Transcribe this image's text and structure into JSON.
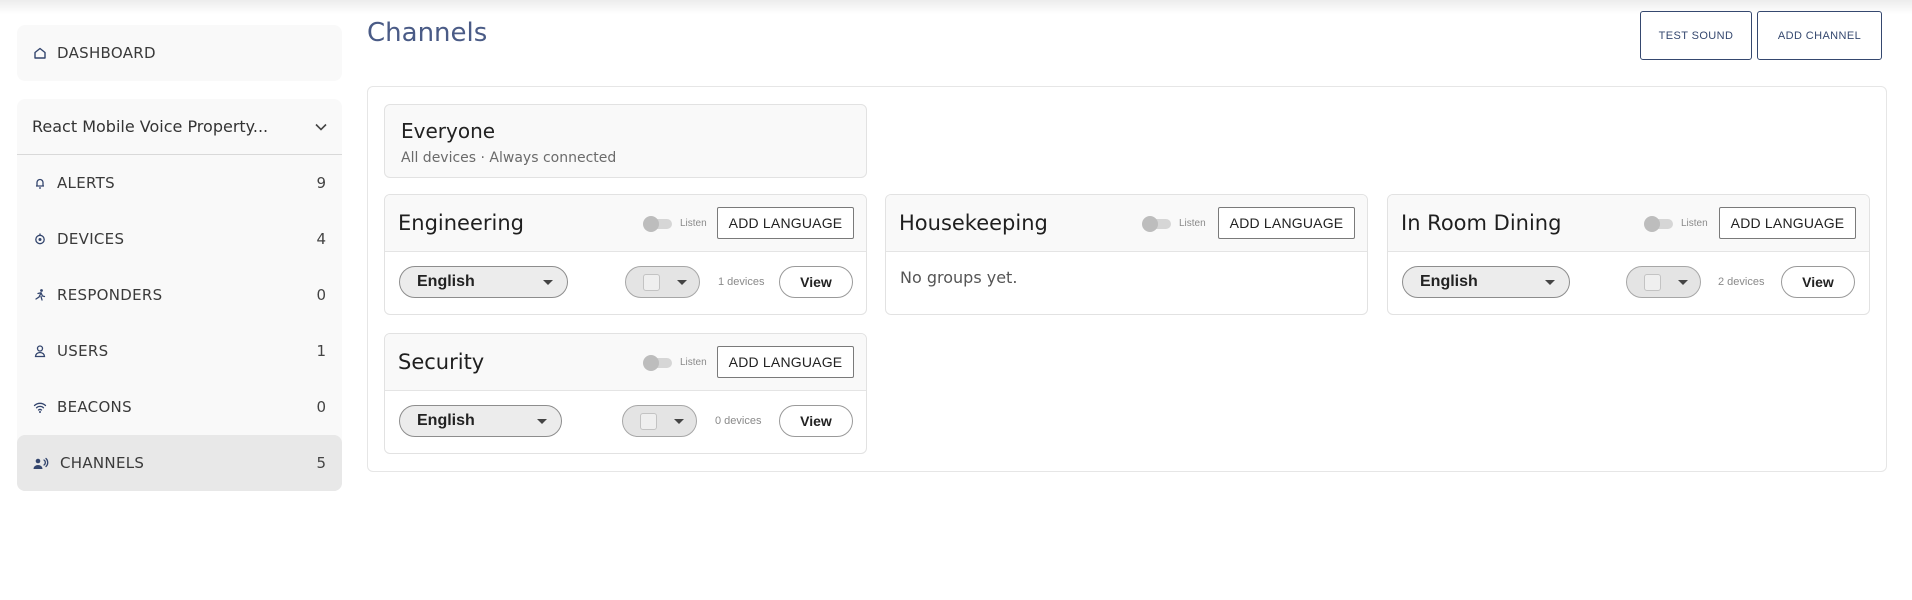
{
  "sidebar": {
    "dashboard": {
      "label": "DASHBOARD",
      "icon": "home-icon"
    },
    "property": {
      "label": "React Mobile Voice Property...",
      "icon": "chevron-down-icon"
    },
    "items": [
      {
        "label": "ALERTS",
        "count": "9",
        "icon": "bell-icon"
      },
      {
        "label": "DEVICES",
        "count": "4",
        "icon": "device-icon"
      },
      {
        "label": "RESPONDERS",
        "count": "0",
        "icon": "runner-icon"
      },
      {
        "label": "USERS",
        "count": "1",
        "icon": "user-icon"
      },
      {
        "label": "BEACONS",
        "count": "0",
        "icon": "wifi-icon"
      },
      {
        "label": "CHANNELS",
        "count": "5",
        "icon": "speaker-person-icon",
        "active": true
      }
    ]
  },
  "header": {
    "title": "Channels",
    "test_sound": "TEST SOUND",
    "add_channel": "ADD CHANNEL"
  },
  "everyone": {
    "title": "Everyone",
    "subtitle": "All devices · Always connected"
  },
  "channels": [
    {
      "name": "Engineering",
      "listen": "Listen",
      "add_language": "ADD LANGUAGE",
      "language": "English",
      "devices": "1 devices",
      "view": "View"
    },
    {
      "name": "Housekeeping",
      "listen": "Listen",
      "add_language": "ADD LANGUAGE",
      "empty": "No groups yet."
    },
    {
      "name": "In Room Dining",
      "listen": "Listen",
      "add_language": "ADD LANGUAGE",
      "language": "English",
      "devices": "2 devices",
      "view": "View"
    },
    {
      "name": "Security",
      "listen": "Listen",
      "add_language": "ADD LANGUAGE",
      "language": "English",
      "devices": "0 devices",
      "view": "View"
    }
  ],
  "colors": {
    "accent": "#35486f",
    "title": "#4a5b86",
    "active_bg": "#e8e8e8"
  }
}
